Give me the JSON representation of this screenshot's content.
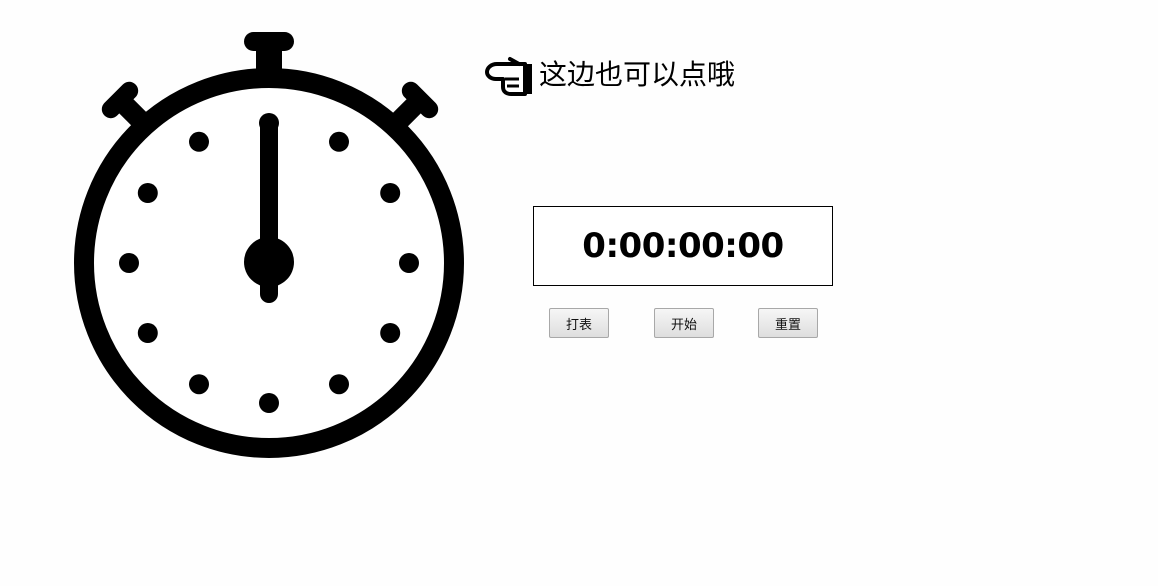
{
  "hint": {
    "text": "这边也可以点哦",
    "icon": "pointing-hand-icon"
  },
  "stopwatch": {
    "icon": "stopwatch-icon",
    "hand_position_seconds": 0
  },
  "timer": {
    "display": "0:00:00:00"
  },
  "buttons": {
    "lap": "打表",
    "start": "开始",
    "reset": "重置"
  }
}
